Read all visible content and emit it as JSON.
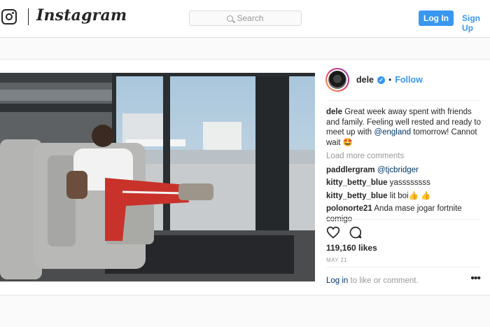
{
  "header": {
    "wordmark": "Instagram",
    "search_placeholder": "Search",
    "login_label": "Log In",
    "signup_label": "Sign Up"
  },
  "post": {
    "author": {
      "username": "dele",
      "follow_label": "Follow",
      "separator": "•"
    },
    "caption": {
      "username": "dele",
      "text_before": "Great week away spent with friends and family. Feeling well rested and ready to meet up with ",
      "mention": "@england",
      "text_after": " tomorrow! Cannot wait 🤩"
    },
    "load_more": "Load more comments",
    "comments": [
      {
        "username": "paddlergram",
        "text": "@tjcbridger"
      },
      {
        "username": "kitty_betty_blue",
        "text": "yassssssss"
      },
      {
        "username": "kitty_betty_blue",
        "text": "lit boi👍 👍"
      },
      {
        "username": "polonorte21",
        "text": "Anda mase jogar fortnite comigo"
      }
    ],
    "likes": "119,160 likes",
    "date": "MAY 21",
    "login_prompt_link": "Log in",
    "login_prompt_text": " to like or comment.",
    "more_glyph": "•••"
  },
  "colors": {
    "accent": "#3897f0",
    "text": "#262626",
    "muted": "#999999"
  },
  "icons": [
    "instagram-camera-icon",
    "search-icon",
    "verified-badge-icon",
    "heart-icon",
    "comment-icon",
    "more-options-icon"
  ]
}
